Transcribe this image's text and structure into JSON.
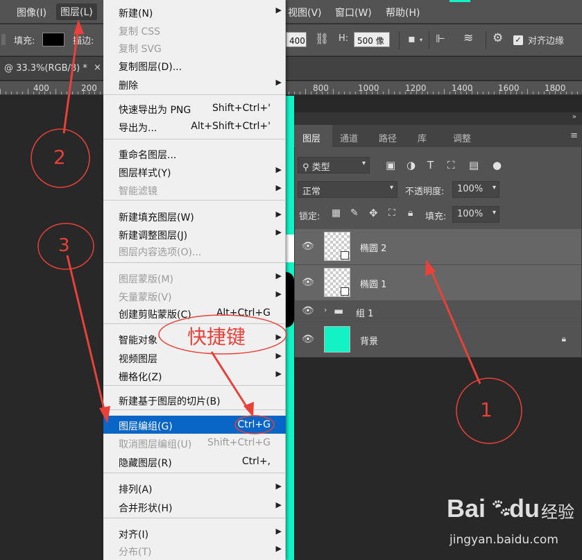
{
  "menubar": {
    "items": [
      {
        "label": "图像(I)"
      },
      {
        "label": "图层(L)"
      },
      {
        "label": "视图(V)"
      },
      {
        "label": "窗口(W)"
      },
      {
        "label": "帮助(H)"
      }
    ]
  },
  "optbar": {
    "fill_label": "填充:",
    "stroke_label": "描边:",
    "w_value": "400 像",
    "h_label": "H:",
    "h_value": "500 像",
    "align_edges_label": "对齐边缘"
  },
  "doctab": {
    "title": "@ 33.3%(RGB/8) *"
  },
  "ruler": {
    "labels": [
      "400",
      "200",
      "800",
      "1000",
      "1200",
      "1400",
      "1600",
      "1800"
    ]
  },
  "menu": {
    "items": [
      {
        "label": "新建(N)",
        "shortcut": "",
        "submenu": true,
        "disabled": false
      },
      {
        "label": "复制 CSS",
        "shortcut": "",
        "submenu": false,
        "disabled": true
      },
      {
        "label": "复制 SVG",
        "shortcut": "",
        "submenu": false,
        "disabled": true
      },
      {
        "label": "复制图层(D)...",
        "shortcut": "",
        "submenu": false,
        "disabled": false
      },
      {
        "label": "删除",
        "shortcut": "",
        "submenu": true,
        "disabled": false
      },
      {
        "label": "快速导出为 PNG",
        "shortcut": "Shift+Ctrl+'",
        "submenu": false,
        "disabled": false
      },
      {
        "label": "导出为...",
        "shortcut": "Alt+Shift+Ctrl+'",
        "submenu": false,
        "disabled": false
      },
      {
        "label": "重命名图层...",
        "shortcut": "",
        "submenu": false,
        "disabled": false
      },
      {
        "label": "图层样式(Y)",
        "shortcut": "",
        "submenu": true,
        "disabled": false
      },
      {
        "label": "智能滤镜",
        "shortcut": "",
        "submenu": true,
        "disabled": true
      },
      {
        "label": "新建填充图层(W)",
        "shortcut": "",
        "submenu": true,
        "disabled": false
      },
      {
        "label": "新建调整图层(J)",
        "shortcut": "",
        "submenu": true,
        "disabled": false
      },
      {
        "label": "图层内容选项(O)...",
        "shortcut": "",
        "submenu": false,
        "disabled": true
      },
      {
        "label": "图层蒙版(M)",
        "shortcut": "",
        "submenu": true,
        "disabled": true
      },
      {
        "label": "矢量蒙版(V)",
        "shortcut": "",
        "submenu": true,
        "disabled": true
      },
      {
        "label": "创建剪贴蒙版(C)",
        "shortcut": "Alt+Ctrl+G",
        "submenu": false,
        "disabled": false
      },
      {
        "label": "智能对象",
        "shortcut": "",
        "submenu": true,
        "disabled": false
      },
      {
        "label": "视频图层",
        "shortcut": "",
        "submenu": true,
        "disabled": false
      },
      {
        "label": "栅格化(Z)",
        "shortcut": "",
        "submenu": true,
        "disabled": false
      },
      {
        "label": "新建基于图层的切片(B)",
        "shortcut": "",
        "submenu": false,
        "disabled": false
      },
      {
        "label": "图层编组(G)",
        "shortcut": "Ctrl+G",
        "submenu": false,
        "disabled": false,
        "highlighted": true
      },
      {
        "label": "取消图层编组(U)",
        "shortcut": "Shift+Ctrl+G",
        "submenu": false,
        "disabled": true
      },
      {
        "label": "隐藏图层(R)",
        "shortcut": "Ctrl+,",
        "submenu": false,
        "disabled": false
      },
      {
        "label": "排列(A)",
        "shortcut": "",
        "submenu": true,
        "disabled": false
      },
      {
        "label": "合并形状(H)",
        "shortcut": "",
        "submenu": true,
        "disabled": false
      },
      {
        "label": "对齐(I)",
        "shortcut": "",
        "submenu": true,
        "disabled": false
      },
      {
        "label": "分布(T)",
        "shortcut": "",
        "submenu": true,
        "disabled": true
      }
    ]
  },
  "layers_panel": {
    "tabs": [
      "图层",
      "通道",
      "路径",
      "库",
      "调整"
    ],
    "filter_label": "类型",
    "blend_mode": "正常",
    "opacity_label": "不透明度:",
    "opacity_value": "100%",
    "lock_label": "锁定:",
    "fill_label": "填充:",
    "fill_value": "100%",
    "layers": [
      {
        "name": "椭圆 2",
        "selected": true
      },
      {
        "name": "椭圆 1",
        "selected": true
      },
      {
        "name": "组 1",
        "selected": false
      },
      {
        "name": "背景",
        "selected": false
      }
    ]
  },
  "annotations": {
    "circle_1": "1",
    "circle_2": "2",
    "circle_3": "3",
    "shortcut_note": "快捷键"
  },
  "watermark": {
    "brand": "Bai",
    "brand2": "du",
    "sub": "经验",
    "url": "jingyan.baidu.com"
  },
  "colors": {
    "menu_highlight": "#0a66c6",
    "annotation_red": "#e8413a",
    "background_layer": "#13f2c4"
  }
}
